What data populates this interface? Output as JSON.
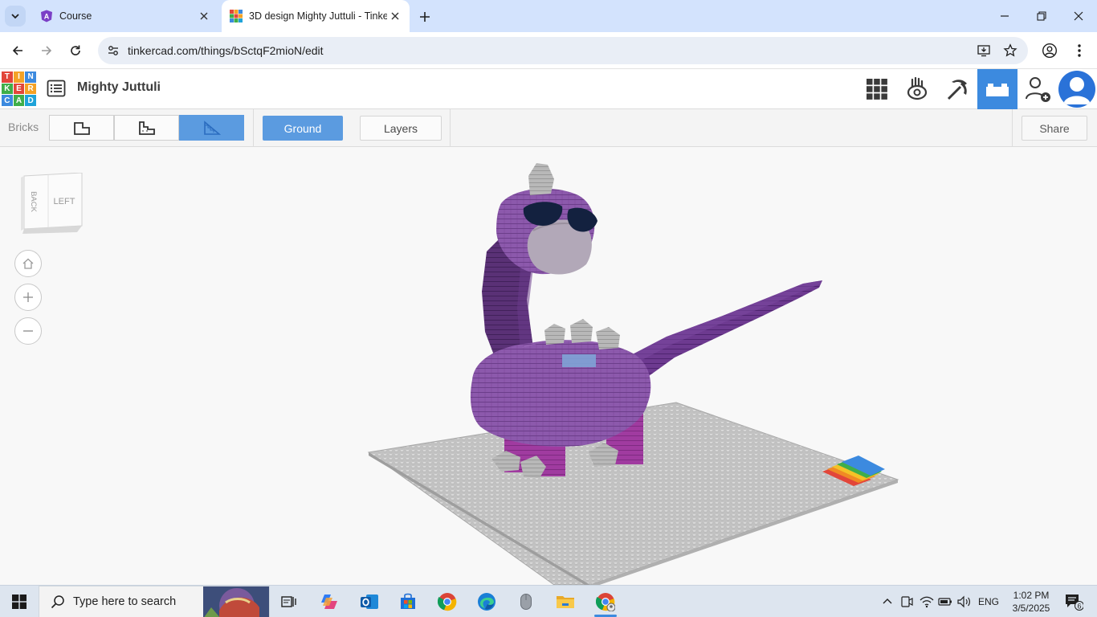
{
  "browser": {
    "tabs": [
      {
        "title": "Course",
        "active": false
      },
      {
        "title": "3D design Mighty Juttuli - Tinkercad",
        "active": true
      }
    ],
    "url": "tinkercad.com/things/bSctqF2mioN/edit"
  },
  "app": {
    "logo_letters": [
      "T",
      "I",
      "N",
      "K",
      "E",
      "R",
      "C",
      "A",
      "D"
    ],
    "design_name": "Mighty Juttuli",
    "header_buttons": [
      "grid-view",
      "sim-lab",
      "minecraft",
      "bricks",
      "invite-users",
      "user-avatar"
    ],
    "active_header_button": "bricks"
  },
  "toolbar": {
    "bricks_label": "Bricks",
    "brick_modes": [
      "full-layers",
      "stepped-layers",
      "slope-layers"
    ],
    "selected_mode": "slope-layers",
    "ground_label": "Ground",
    "layers_label": "Layers",
    "share_label": "Share"
  },
  "viewcube": {
    "back_label": "BACK",
    "left_label": "LEFT"
  },
  "taskbar": {
    "search_placeholder": "Type here to search",
    "apps": [
      "task-view",
      "copilot",
      "outlook",
      "microsoft-store",
      "chrome",
      "edge",
      "mouse-app",
      "file-explorer",
      "chrome-profile"
    ],
    "language": "ENG",
    "time": "1:02 PM",
    "date": "3/5/2025",
    "notification_count": "6"
  },
  "colors": {
    "accent": "#3c8adf",
    "selected": "#5b9be0",
    "tab_strip": "#d3e3fd",
    "dino_purple": "#7d4a9c",
    "dino_dark": "#4e2a66",
    "baseplate": "#c7c7c7"
  }
}
